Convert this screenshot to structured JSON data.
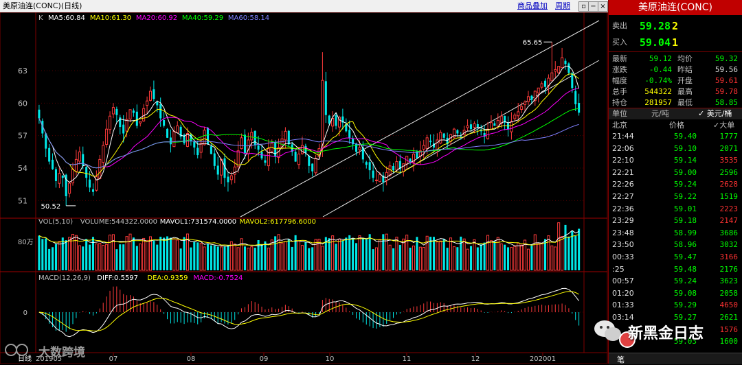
{
  "window": {
    "title": "美原油连(CONC)(日线)",
    "link_add": "商品叠加",
    "link_period": "周期",
    "ctrl_icons": [
      "restore-icon",
      "minimize-icon",
      "maximize-icon",
      "close-icon"
    ]
  },
  "main_chart": {
    "marker": "K",
    "ma_labels": [
      {
        "text": "MA5:60.84",
        "color": "#ffffff"
      },
      {
        "text": "MA10:61.30",
        "color": "#ffff00"
      },
      {
        "text": "MA20:60.92",
        "color": "#ff00ff"
      },
      {
        "text": "MA40:59.29",
        "color": "#00ff00"
      },
      {
        "text": "MA60:58.14",
        "color": "#8080ff"
      }
    ],
    "y_ticks": [
      "63",
      "60",
      "57",
      "54",
      "51"
    ],
    "high_label": "65.65",
    "low_label": "50.52"
  },
  "volume_panel": {
    "labels": [
      {
        "text": "VOL(5,10)",
        "color": "#c0c0c0"
      },
      {
        "text": "VOLUME:544322.0000",
        "color": "#c0c0c0"
      },
      {
        "text": "MAVOL1:731574.0000",
        "color": "#ffffff"
      },
      {
        "text": "MAVOL2:617796.6000",
        "color": "#ffff00"
      }
    ],
    "y_tick": "80万"
  },
  "macd_panel": {
    "labels": [
      {
        "text": "MACD(12,26,9)",
        "color": "#c0c0c0"
      },
      {
        "text": "DIFF:0.5597",
        "color": "#ffffff"
      },
      {
        "text": "DEA:0.9359",
        "color": "#ffff00"
      },
      {
        "text": "MACD:-0.7524",
        "color": "#ff00ff"
      }
    ],
    "y_tick": "0"
  },
  "x_axis": {
    "period_tab": "日线",
    "start": "201905",
    "months": [
      "07",
      "08",
      "09",
      "10",
      "11",
      "12",
      "202001"
    ]
  },
  "chart_data": {
    "type": "candlestick",
    "symbol": "CONC",
    "period": "daily",
    "price_range": [
      49.5,
      67.5
    ],
    "highest": 65.65,
    "lowest": 50.52,
    "last_close": 59.12,
    "ma": {
      "MA5": 60.84,
      "MA10": 61.3,
      "MA20": 60.92,
      "MA40": 59.29,
      "MA60": 58.14
    },
    "volume": {
      "VOLUME": 544322.0,
      "MAVOL1": 731574.0,
      "MAVOL2": 617796.6
    },
    "macd": {
      "DIFF": 0.5597,
      "DEA": 0.9359,
      "MACD": -0.7524
    },
    "closes": [
      58.6,
      57.2,
      55.8,
      54.6,
      53.9,
      52.8,
      53.5,
      53.1,
      51.4,
      52.6,
      53.9,
      54.8,
      55.5,
      54.2,
      53.1,
      52.2,
      51.8,
      53.2,
      54.8,
      56.1,
      57.6,
      58.8,
      59.6,
      58.9,
      57.8,
      57.2,
      58.5,
      59.4,
      59.1,
      57.9,
      58.3,
      59.5,
      60.2,
      61.1,
      60.4,
      59.8,
      58.6,
      57.9,
      56.8,
      56.2,
      57.4,
      57.9,
      56.9,
      56.3,
      57.2,
      56.5,
      55.9,
      55.2,
      56.3,
      57.5,
      56.2,
      55.3,
      54.2,
      53.4,
      54.8,
      53.1,
      52.7,
      53.3,
      54.1,
      55.6,
      56.8,
      55.4,
      56.6,
      57.3,
      56.1,
      55.7,
      54.9,
      54.5,
      55.8,
      56.3,
      55.1,
      55.9,
      56.7,
      57.4,
      56.2,
      55.5,
      54.6,
      55.3,
      56.1,
      55.4,
      54.2,
      53.7,
      54.9,
      55.8,
      62.1,
      58.9,
      58.1,
      58.6,
      57.9,
      58.7,
      58.2,
      57.4,
      56.8,
      56.2,
      55.5,
      55.9,
      54.8,
      54.3,
      53.8,
      53.1,
      52.9,
      53.4,
      52.7,
      53.6,
      54.2,
      53.8,
      54.6,
      53.9,
      54.4,
      55.1,
      54.6,
      55.3,
      54.9,
      55.6,
      56.1,
      56.8,
      56.4,
      55.9,
      56.6,
      57.3,
      56.8,
      56.2,
      57.1,
      57.6,
      57.2,
      56.9,
      57.5,
      57.9,
      57.6,
      58.1,
      57.8,
      57.4,
      56.9,
      57.6,
      58.2,
      57.9,
      58.4,
      58.8,
      58.2,
      57.6,
      58.3,
      58.9,
      59.2,
      59.7,
      60.1,
      60.6,
      60.3,
      61.1,
      61.4,
      61.8,
      61.5,
      62.3,
      62.8,
      63.1,
      63.4,
      64.2,
      63.6,
      62.8,
      61.4,
      59.9,
      59.12
    ]
  },
  "quote_panel": {
    "title": "美原油连(CONC)",
    "ask": {
      "label": "卖出",
      "price": "59.28",
      "qty": "2"
    },
    "bid": {
      "label": "买入",
      "price": "59.04",
      "qty": "1"
    },
    "stats": [
      {
        "l1": "最新",
        "v1": "59.12",
        "c1": "g",
        "l2": "均价",
        "v2": "59.32",
        "c2": "g"
      },
      {
        "l1": "涨跌",
        "v1": "-0.44",
        "c1": "g",
        "l2": "昨结",
        "v2": "59.56",
        "c2": "w"
      },
      {
        "l1": "幅度",
        "v1": "-0.74%",
        "c1": "g",
        "l2": "开盘",
        "v2": "59.61",
        "c2": "r"
      },
      {
        "l1": "总手",
        "v1": "544322",
        "c1": "y",
        "l2": "最高",
        "v2": "59.78",
        "c2": "r"
      },
      {
        "l1": "持仓",
        "v1": "281957",
        "c1": "y",
        "l2": "最低",
        "v2": "58.85",
        "c2": "g"
      }
    ],
    "unit_label": "单位",
    "unit_value": "元/吨",
    "unit_alt": "✓ 美元/桶",
    "ticks_header": {
      "time": "北京",
      "price": "价格",
      "vol": "✓大单"
    },
    "ticks": [
      {
        "time": "21:44",
        "price": "59.40",
        "vol": "1777",
        "vc": "g"
      },
      {
        "time": "22:06",
        "price": "59.10",
        "vol": "2071",
        "vc": "g"
      },
      {
        "time": "22:10",
        "price": "59.14",
        "vol": "3535",
        "vc": "r"
      },
      {
        "time": "22:21",
        "price": "59.00",
        "vol": "2596",
        "vc": "g"
      },
      {
        "time": "22:26",
        "price": "59.24",
        "vol": "2628",
        "vc": "r"
      },
      {
        "time": "22:27",
        "price": "59.22",
        "vol": "1519",
        "vc": "g"
      },
      {
        "time": "22:36",
        "price": "59.01",
        "vol": "2223",
        "vc": "r"
      },
      {
        "time": "23:29",
        "price": "59.18",
        "vol": "2147",
        "vc": "r"
      },
      {
        "time": "23:48",
        "price": "58.99",
        "vol": "3686",
        "vc": "g"
      },
      {
        "time": "23:50",
        "price": "58.96",
        "vol": "3032",
        "vc": "g"
      },
      {
        "time": "00:33",
        "price": "59.47",
        "vol": "3166",
        "vc": "r"
      },
      {
        "time": ":25",
        "price": "59.48",
        "vol": "2176",
        "vc": "g"
      },
      {
        "time": "00:57",
        "price": "59.24",
        "vol": "3623",
        "vc": "g"
      },
      {
        "time": "01:20",
        "price": "59.08",
        "vol": "2058",
        "vc": "g"
      },
      {
        "time": "01:33",
        "price": "59.29",
        "vol": "4650",
        "vc": "r"
      },
      {
        "time": "03:14",
        "price": "59.27",
        "vol": "2621",
        "vc": "g"
      },
      {
        "time": "",
        "price": "",
        "vol": "1576",
        "vc": "r"
      },
      {
        "time": "",
        "price": "59.03",
        "vol": "1600",
        "vc": "g"
      }
    ],
    "footer_tab": "笔"
  },
  "watermarks": {
    "left": "大数跨境",
    "right": "新黑金日志"
  }
}
